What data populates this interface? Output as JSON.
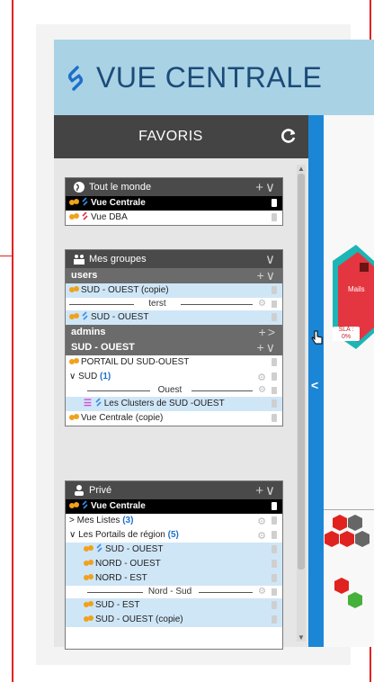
{
  "app": {
    "title": "VUE CENTRALE",
    "brand_color": "#1b4b78",
    "header_color": "#a9d2e5"
  },
  "favoris": {
    "title": "FAVORIS",
    "refresh_icon": "refresh-icon"
  },
  "cards": {
    "tout_le_monde": {
      "title": "Tout le monde",
      "items": [
        {
          "label": "Vue Centrale",
          "selected": true
        },
        {
          "label": "Vue DBA"
        }
      ]
    },
    "mes_groupes": {
      "title": "Mes groupes",
      "sections": {
        "users": "users",
        "admins": "admins",
        "sud_ouest": "SUD - OUEST"
      },
      "users_items": [
        {
          "label": "SUD - OUEST (copie)"
        },
        {
          "label": "SUD - OUEST"
        }
      ],
      "users_divider": "terst",
      "sud_ouest_items": {
        "portail": "PORTAIL DU SUD-OUEST",
        "sud": "SUD",
        "sud_count": "(1)",
        "divider": "Ouest",
        "clusters": "Les Clusters de SUD -OUEST",
        "vue_copie": "Vue Centrale (copie)"
      }
    },
    "prive": {
      "title": "Privé",
      "vue_centrale": "Vue Centrale",
      "mes_listes": "Mes Listes",
      "mes_listes_count": "(3)",
      "portails": "Les Portails de région",
      "portails_count": "(5)",
      "portails_items": [
        "SUD - OUEST",
        "NORD - OUEST",
        "NORD - EST"
      ],
      "divider": "Nord - Sud",
      "more_items": [
        "SUD - EST",
        "SUD - OUEST (copie)"
      ]
    }
  },
  "canvas": {
    "mails_label": "Mails",
    "sla_label": "SLA :",
    "sla_value": "0%"
  }
}
